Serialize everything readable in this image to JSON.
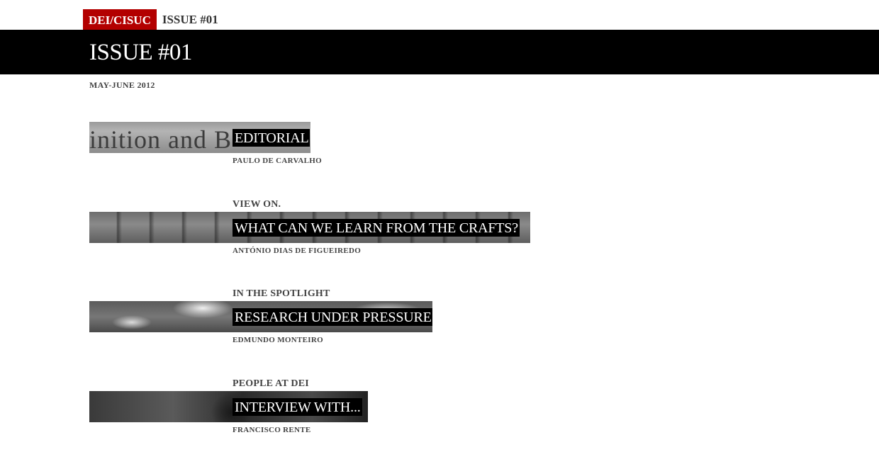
{
  "header": {
    "site_label": "DEI/CISUC",
    "breadcrumb_issue": "ISSUE #01",
    "title": "ISSUE #01",
    "date": "MAY-JUNE 2012"
  },
  "articles": [
    {
      "kicker": "",
      "headline": "EDITORIAL",
      "author": "PAULO DE CARVALHO",
      "background_text": "inition and B"
    },
    {
      "kicker": "VIEW ON.",
      "headline": "WHAT CAN WE LEARN FROM THE CRAFTS?",
      "author": "ANTÓNIO DIAS DE FIGUEIREDO"
    },
    {
      "kicker": "IN THE SPOTLIGHT",
      "headline": "RESEARCH UNDER PRESSURE",
      "author": "EDMUNDO MONTEIRO"
    },
    {
      "kicker": "PEOPLE AT DEI",
      "headline": "INTERVIEW WITH...",
      "author": "FRANCISCO RENTE"
    }
  ],
  "colors": {
    "brand_red": "#b30000",
    "title_bar": "#000000"
  }
}
